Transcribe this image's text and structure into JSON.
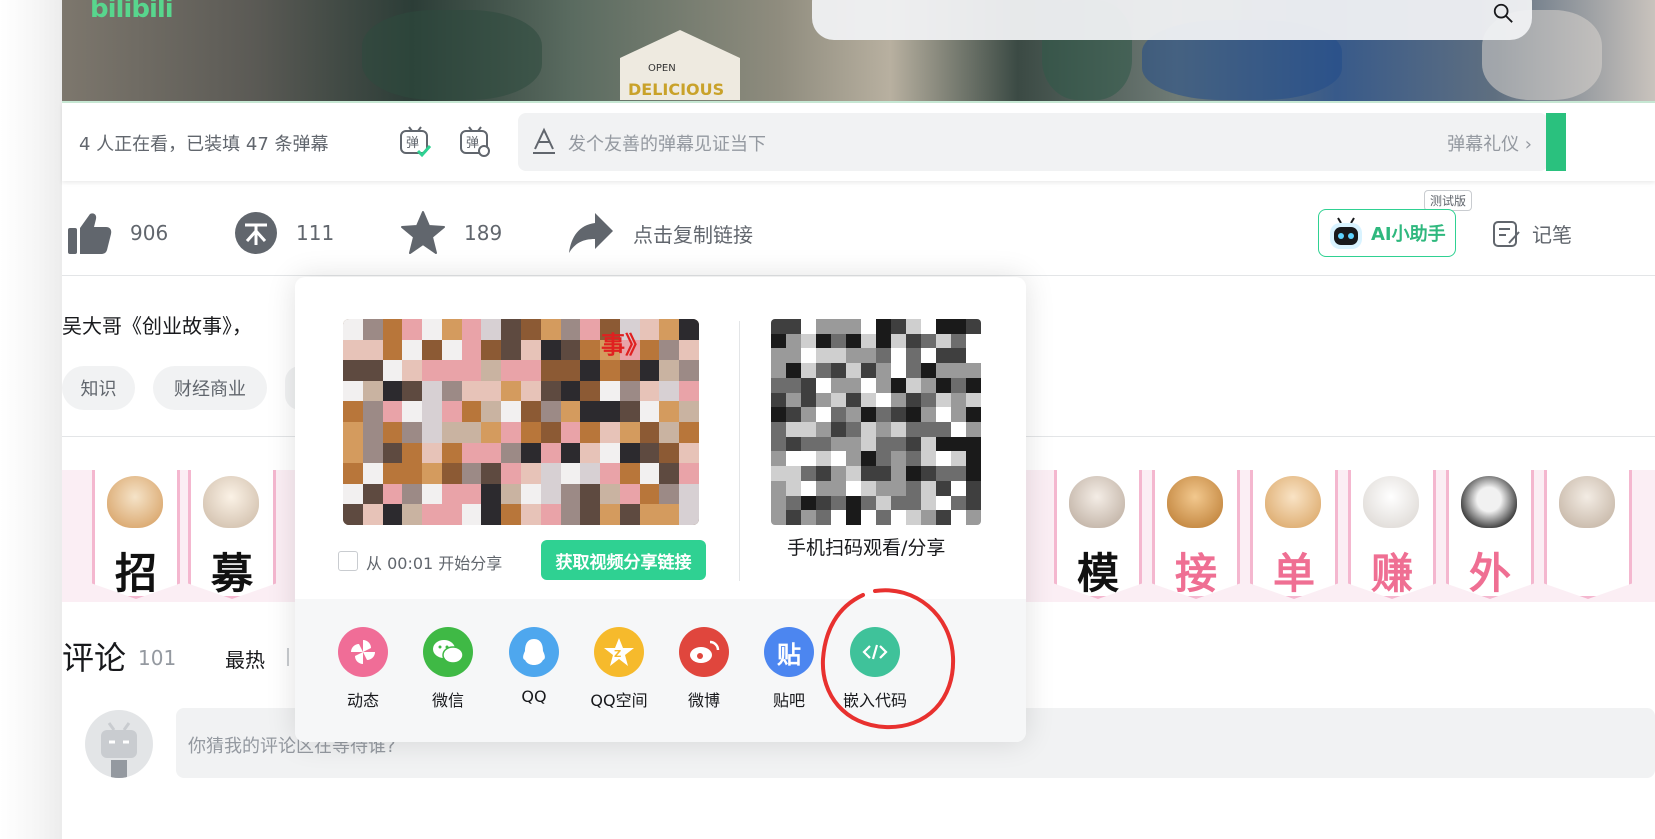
{
  "video": {
    "logo_text": "bilibili",
    "sign_open": "OPEN",
    "sign_text": "DELICIOUS"
  },
  "danmaku": {
    "viewer_status": "4 人正在看，已装填 47 条弹幕",
    "toggle_on_icon": "danmaku-on-icon",
    "settings_icon": "danmaku-settings-icon",
    "placeholder": "发个友善的弹幕见证当下",
    "etiquette": "弹幕礼仪 ›"
  },
  "toolbar": {
    "like_count": "906",
    "coin_count": "111",
    "fav_count": "189",
    "share_label": "点击复制链接",
    "ai_beta_badge": "测试版",
    "ai_label": "AI小助手",
    "note_label": "记笔"
  },
  "description": "吴大哥《创业故事》，",
  "tags": [
    "知识",
    "财经商业"
  ],
  "banner": {
    "chars_left": [
      "招",
      "募"
    ],
    "chars_right": [
      "模",
      "接",
      "单",
      "赚",
      "外"
    ],
    "colors": {
      "black_char": "#111111",
      "pink_char": "#ef6f93"
    }
  },
  "share_popup": {
    "thumb_title": "事》",
    "start_share_label": "从 00:01 开始分享",
    "get_link_button": "获取视频分享链接",
    "qr_caption": "手机扫码观看/分享",
    "targets": [
      {
        "label": "动态",
        "icon": "dynamic-icon",
        "color": "#f06d97"
      },
      {
        "label": "微信",
        "icon": "wechat-icon",
        "color": "#3fb945"
      },
      {
        "label": "QQ",
        "icon": "qq-icon",
        "color": "#4ea7ee"
      },
      {
        "label": "QQ空间",
        "icon": "qzone-icon",
        "color": "#f6ba2c"
      },
      {
        "label": "微博",
        "icon": "weibo-icon",
        "color": "#e0463d"
      },
      {
        "label": "贴吧",
        "icon": "tieba-icon",
        "color": "#4c86f0"
      },
      {
        "label": "嵌入代码",
        "icon": "embed-code-icon",
        "color": "#3fc29a"
      }
    ]
  },
  "comments": {
    "title": "评论",
    "count": "101",
    "sort_hot": "最热",
    "placeholder": "你猜我的评论区在等待谁?"
  },
  "colors": {
    "accent_green": "#2fd192",
    "annotation_red": "#e8312f"
  }
}
